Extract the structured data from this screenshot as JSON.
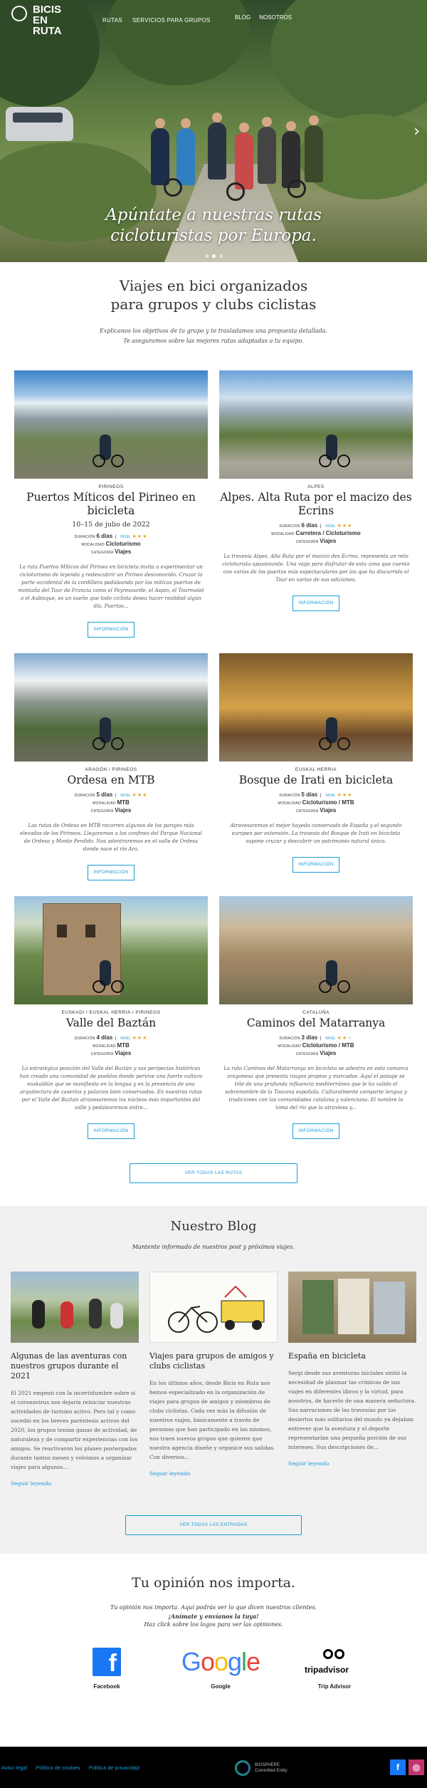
{
  "nav": {
    "logo": "BICIS EN RUTA",
    "items": [
      "RUTAS",
      "SERVICIOS PARA GRUPOS"
    ],
    "items_right": [
      "BLOG",
      "NOSOTROS"
    ]
  },
  "hero": {
    "caption": "Apúntate a nuestras rutas cicloturistas por Europa.",
    "slides": 3
  },
  "intro": {
    "title_line1": "Viajes en bici organizados",
    "title_line2": "para grupos y clubs ciclistas",
    "text_line1": "Explícanos los objetivos de tu grupo y te trasladamos una propuesta detallada.",
    "text_line2": "Te aseguramos sobre las mejores rutas adaptadas a tu equipo."
  },
  "labels": {
    "duracion": "DURACIÓN",
    "nivel": "NIVEL",
    "modalidad": "MODALIDAD",
    "categoria": "CATEGORÍA",
    "info_button": "INFORMACIÓN",
    "all_routes": "VER TODAS LAS RUTAS"
  },
  "trips": [
    {
      "region": "PIRINEOS",
      "title": "Puertos Míticos del Pirineo en bicicleta",
      "date": "10–15 de julio de 2022",
      "duration": "6 días",
      "level": 3,
      "modality": "Cicloturismo",
      "category": "Viajes",
      "desc": "La ruta Puertos Míticos del Pirineo en bicicleta invita a experimentar un cicloturismo de leyenda y redescubrir un Pirineo desconocido. Cruzar la parte occidental de la cordillera pedaleando por los míticos puertos de montaña del Tour de Francia como el Peyresourde, el Aspin, el Tourmalet o el Aubisque, es un sueño que todo ciclista desea hacer realidad algún día. Puertos..."
    },
    {
      "region": "ALPES",
      "title": "Alpes. Alta Ruta por el macizo des Ecrins",
      "date": "",
      "duration": "6 días",
      "level": 3,
      "modality": "Carretera / Cicloturismo",
      "category": "Viajes",
      "desc": "La travesía Alpes. Alta Ruta por el macizo des Ecrins, representa un reto cicloturista apasionante. Una viaje para disfrutar de esta zona que cuenta con varios de los puertos más espectaculares por los que ha discurrido el Tour en varias de sus ediciones."
    },
    {
      "region": "ARAGÓN / PIRINEOS",
      "title": "Ordesa en MTB",
      "date": "",
      "duration": "5 días",
      "level": 3,
      "modality": "MTB",
      "category": "Viajes",
      "desc": "Las rutas de Ordesa en MTB recorren algunos de los parajes más elevados de los Pirineos. Llegaremos a los confines del Parque Nacional de Ordesa y Monte Perdido. Nos adentraremos en el valle de Ordesa donde nace el río Ara."
    },
    {
      "region": "EUSKAL HERRIA",
      "title": "Bosque de Irati en bicicleta",
      "date": "",
      "duration": "5 días",
      "level": 3,
      "modality": "Cicloturismo / MTB",
      "category": "Viajes",
      "desc": "Atravesaremos el mejor hayedo conservado de España y el segundo europeo por extensión. La travesía del Bosque de Irati en bicicleta supone cruzar y descubrir un patrimonio natural único."
    },
    {
      "region": "EUSKADI / EUSKAL HERRIA / PIRINEOS",
      "title": "Valle del Baztán",
      "date": "",
      "duration": "4 días",
      "level": 3,
      "modality": "MTB",
      "category": "Viajes",
      "desc": "La estratégica posición del Valle del Baztán y sus peripecias históricas han creado una comunidad de pueblos donde pervive una fuerte cultura euskaldún que se manifiesta en la lengua y en la presencia de una arquitectura de caseríos y palacios bien conservados. En nuestras rutas por el Valle del Baztán atravesaremos los núcleos más importantes del valle y pedalearemos entre..."
    },
    {
      "region": "CATALUÑA",
      "title": "Caminos del Matarranya",
      "date": "",
      "duration": "3 días",
      "level": 2,
      "modality": "Cicloturismo / MTB",
      "category": "Viajes",
      "desc": "La ruta Caminos del Matarranya en bicicleta se adentra en esta comarca aragonesa que presenta rasgos propios y marcados. Aquí el paisaje se tiñe de una profunda influencia mediterránea que le ha valido el sobrenombre de la Toscana española. Culturalmente comparte lengua y tradiciones con las comunidades catalana y valenciana. El nombre lo toma del río que la atraviesa y..."
    }
  ],
  "blog": {
    "title": "Nuestro Blog",
    "subtitle": "Mantente informado de nuestros post y próximos viajes.",
    "read_more": "Seguir leyendo",
    "all_posts": "VER TODAS LAS ENTRADAS",
    "posts": [
      {
        "title": "Algunas de las aventuras con nuestros grupos durante el 2021",
        "text": "El 2021 empezó con la incertidumbre sobre si el coronavirus nos dejaría reiniciar nuestras actividades de turismo activo. Pero tal y como sucedió en los breves paréntesis activos del 2020, los grupos tenían ganas de actividad, de naturaleza y de compartir experiencias con los amigos. Se reactivaron los planes postergados durante tantos meses y volvimos a organizar viajes para algunos..."
      },
      {
        "title": "Viajes para grupos de amigos y clubs ciclistas",
        "text": "En los últimos años, desde Bicis en Ruta nos hemos especializado en la organización de viajes para grupos de amigos y miembros de clubs ciclistas. Cada vez más la difusión de nuestros viajes, básicamente a través de personas que han participado en los mismos, nos traen nuevos grupos que quieren que nuestra agencia diseñe y organice sus salidas. Con diversos..."
      },
      {
        "title": "España en bicicleta",
        "text": "Sergi desde sus aventuras iniciales sintió la necesidad de plasmar las crónicas de sus viajes en diferentes libros y la virtud, para nosotros, de hacerlo de una manera seductora. Sus narraciones de las travesías por los desiertos más solitarios del mundo ya dejaban entrever que la aventura y el deporte representarían una pequeña porción de sus intereses. Sus descripciones de..."
      }
    ]
  },
  "opinion": {
    "title": "Tu opinión nos importa.",
    "line1": "Tu opinión nos importa. Aquí podrás ver lo que dicen nuestros clientes.",
    "line2": "¡Anímate y envíanos la tuya!",
    "line3": "Haz click sobre los logos para ver las opiniones.",
    "platforms": [
      "Facebook",
      "Google",
      "Trip Advisor"
    ],
    "google_logo": "Google",
    "tripadvisor_logo": "tripadvisor"
  },
  "footer": {
    "links": [
      "Aviso legal",
      "Política de cookies",
      "Política de privacidad"
    ],
    "biosphere_line1": "BIOSPHERE",
    "biosphere_line2": "Committed Entity",
    "colors": {
      "facebook": "#1877f2",
      "instagram": "#c1356e"
    }
  },
  "colors": {
    "accent": "#1a9bd7",
    "stars": "#e5a82a",
    "footer_bg": "#000000",
    "blog_bg": "#f1f1f1"
  }
}
